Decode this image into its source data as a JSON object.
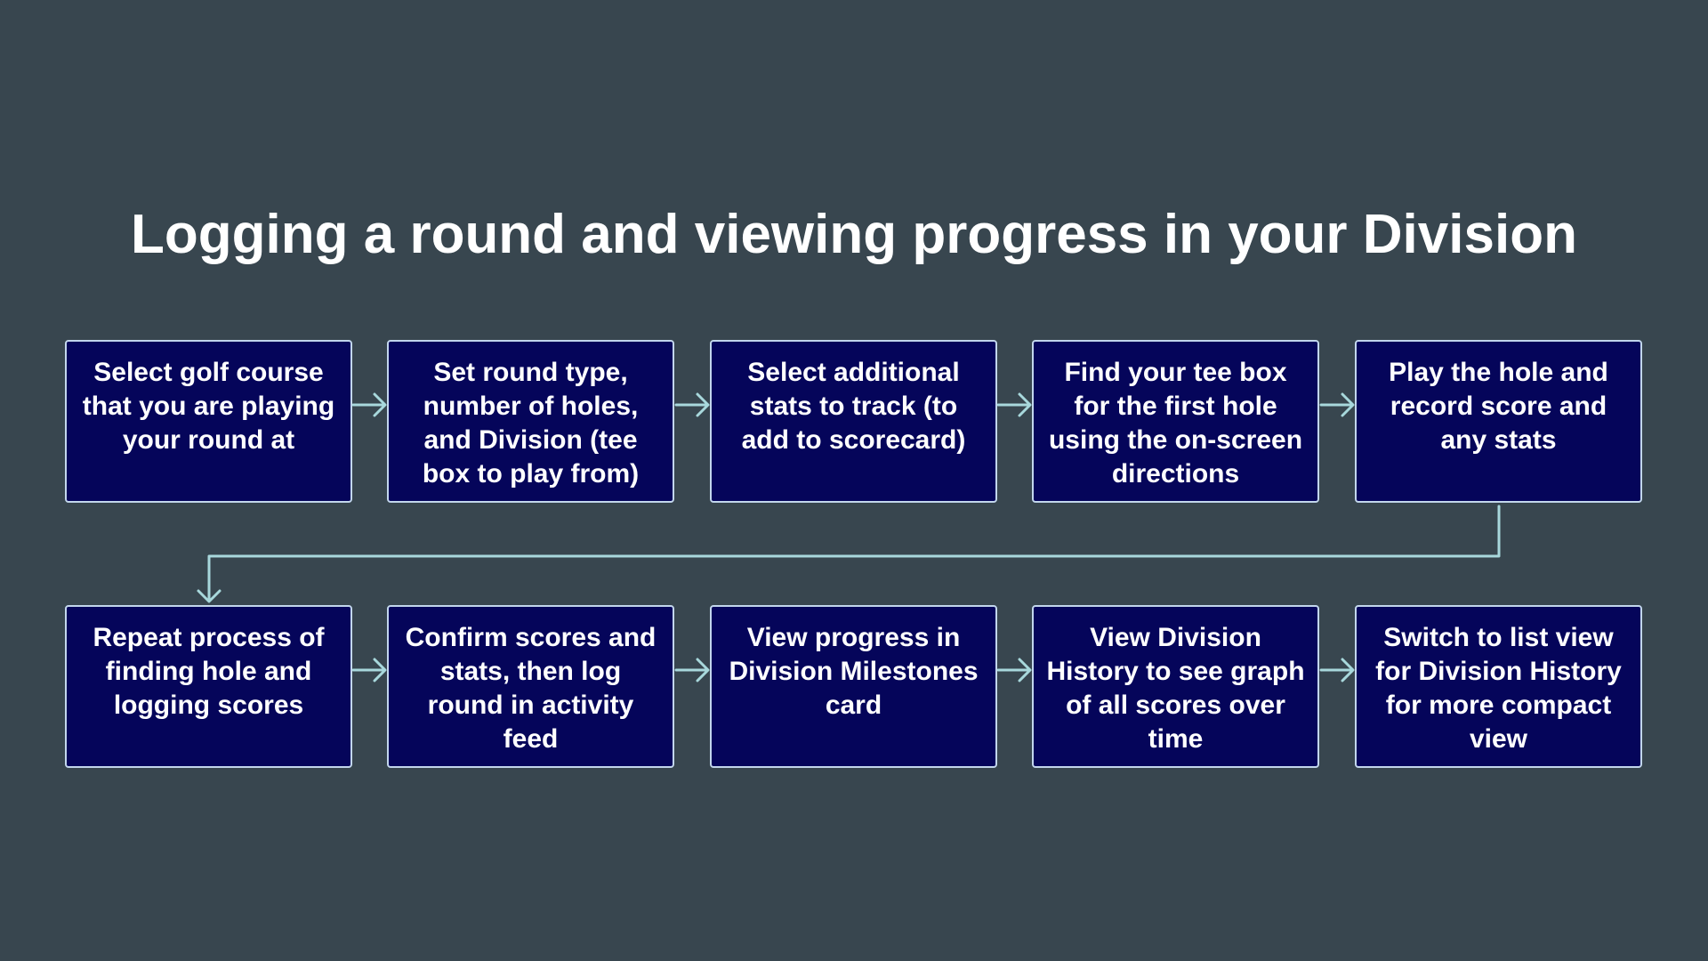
{
  "title": "Logging a round and viewing progress in your Division",
  "colors": {
    "background": "#38464f",
    "box_fill": "#05055a",
    "box_border": "#c2d6ec",
    "connector": "#a8d8dc",
    "text": "#ffffff"
  },
  "steps": [
    {
      "label": "Select golf course that you are playing your round at"
    },
    {
      "label": "Set round type, number of holes, and Division (tee box to play from)"
    },
    {
      "label": "Select additional stats to track (to add to scorecard)"
    },
    {
      "label": "Find your tee box for the first hole using the on-screen directions"
    },
    {
      "label": "Play the hole and record score and any stats"
    },
    {
      "label": "Repeat process of finding hole and logging scores"
    },
    {
      "label": "Confirm scores and stats, then log round in activity feed"
    },
    {
      "label": "View progress in Division Milestones card"
    },
    {
      "label": "View Division History to see graph of all scores over time"
    },
    {
      "label": "Switch to list view for Division History for more compact view"
    }
  ]
}
